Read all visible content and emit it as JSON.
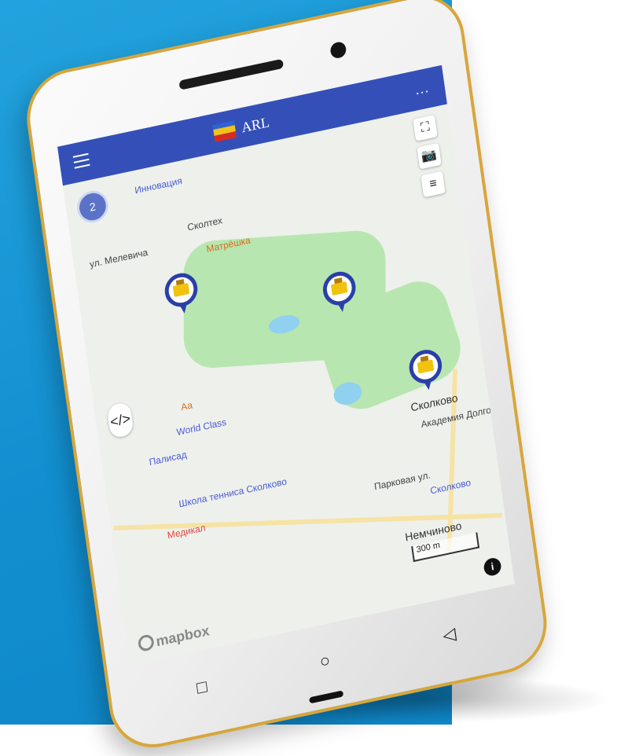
{
  "app": {
    "title": "ARL",
    "menu_icon": "hamburger-icon",
    "more_icon": "more-icon",
    "more_label": "...",
    "brand_colors": {
      "appbar": "#3450b8",
      "pin": "#2a3fa8",
      "pin_glyph": "#f1c30e"
    }
  },
  "map": {
    "cluster_count": "2",
    "controls": [
      {
        "icon": "fullscreen-icon",
        "label": "⛶"
      },
      {
        "icon": "screenshot-icon",
        "label": "📷"
      },
      {
        "icon": "layers-icon",
        "label": "≡"
      }
    ],
    "collapse_label": "</>",
    "labels": {
      "inovacia": "Инновация",
      "street_mel": "ул. Мелевича",
      "skoltech": "Сколтех",
      "matreshka": "Матрёшка",
      "world_class": "World Class",
      "palisad": "Палисад",
      "aa": "Аа",
      "skolkovo": "Сколково",
      "academy": "Академия Долголетия",
      "tennis": "Школа тенниса Сколково",
      "medical": "Медикал",
      "parkovaya": "Парковая ул.",
      "skolkovo_station": "Сколково",
      "nemchinovo": "Немчиново"
    },
    "scale_label": "300 m",
    "info_label": "i",
    "attribution": "mapbox"
  },
  "nav": {
    "recent_icon": "square-icon",
    "home_icon": "circle-icon",
    "back_icon": "triangle-icon",
    "recent_label": "□",
    "home_label": "○",
    "back_label": "◁"
  }
}
